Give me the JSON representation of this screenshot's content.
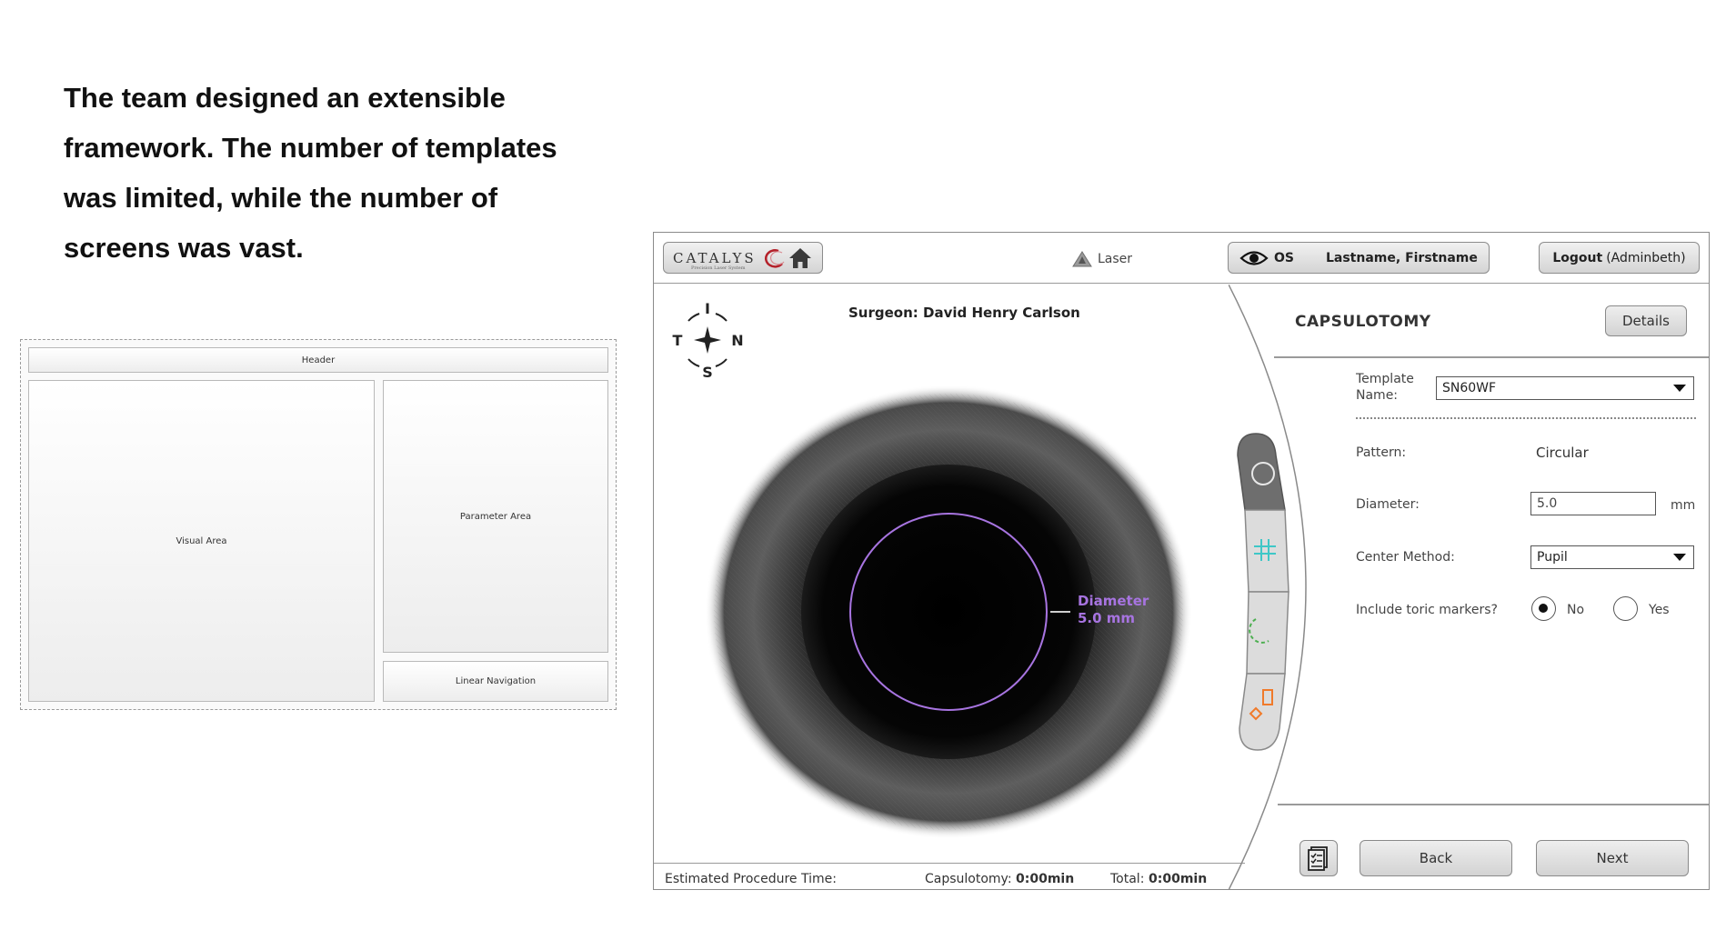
{
  "intro": {
    "line1": "The team designed an extensible",
    "line2": "framework. The number of templates",
    "line3": "was limited, while the number of",
    "line4": "screens was vast."
  },
  "wireframe": {
    "header": "Header",
    "visual_area": "Visual Area",
    "parameter_area": "Parameter Area",
    "linear_navigation": "Linear Navigation"
  },
  "app": {
    "logo": "CATALYS",
    "logo_sub": "Precision Laser System",
    "laser_label": "Laser",
    "eye": "OS",
    "patient_name": "Lastname, Firstname",
    "logout_label": "Logout",
    "logout_user": "(Adminbeth)",
    "surgeon": "Surgeon: David Henry Carlson",
    "compass": {
      "top": "I",
      "left": "T",
      "right": "N",
      "bottom": "S"
    },
    "overlay": {
      "line1": "Diameter",
      "line2": "5.0 mm"
    },
    "footer": {
      "estimated": "Estimated Procedure Time:",
      "capsulotomy_label": "Capsulotomy:",
      "capsulotomy_value": "0:00min",
      "total_label": "Total:",
      "total_value": "0:00min"
    },
    "params": {
      "title": "CAPSULOTOMY",
      "details_label": "Details",
      "template_label_1": "Template",
      "template_label_2": "Name:",
      "template_value": "SN60WF",
      "pattern_label": "Pattern:",
      "pattern_value": "Circular",
      "diameter_label": "Diameter:",
      "diameter_value": "5.0",
      "diameter_unit": "mm",
      "center_label": "Center Method:",
      "center_value": "Pupil",
      "toric_label": "Include toric markers?",
      "toric_no": "No",
      "toric_yes": "Yes"
    },
    "nav": {
      "back_label": "Back",
      "next_label": "Next"
    },
    "colors": {
      "accent_purple": "#a774e0",
      "teal": "#3ec7c7",
      "orange": "#f07a2a"
    }
  }
}
